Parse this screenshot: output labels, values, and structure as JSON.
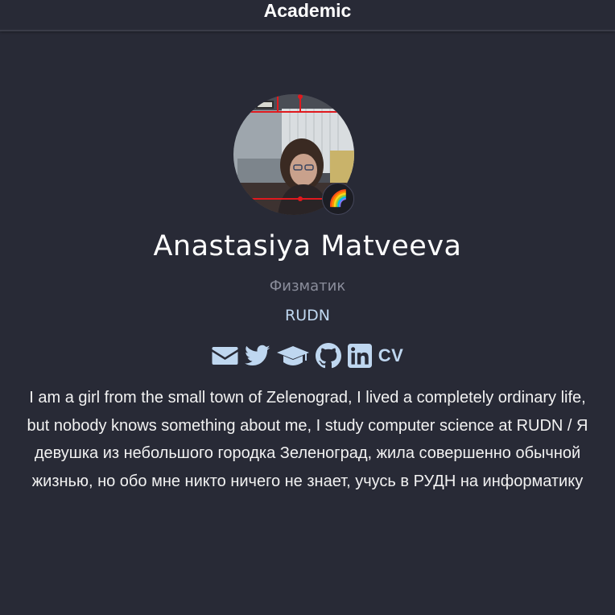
{
  "navbar": {
    "brand": "Academic"
  },
  "profile": {
    "name": "Anastasiya Matveeva",
    "role": "Физматик",
    "organization": "RUDN",
    "status_emoji": "🌈",
    "avatar_description_icon": "user-photo",
    "social": [
      {
        "name": "email",
        "icon": "envelope-icon"
      },
      {
        "name": "twitter",
        "icon": "twitter-icon"
      },
      {
        "name": "scholar",
        "icon": "graduation-cap-icon"
      },
      {
        "name": "github",
        "icon": "github-icon"
      },
      {
        "name": "linkedin",
        "icon": "linkedin-icon"
      },
      {
        "name": "cv",
        "label": "CV",
        "icon": "cv-icon"
      }
    ],
    "bio": "I am a girl from the small town of Zelenograd, I lived a completely ordinary life, but nobody knows something about me, I study computer science at RUDN / Я девушка из небольшого городка Зеленоград, жила совершенно обычной жизнью, но обо мне никто ничего не знает, учусь в РУДН на информатику"
  },
  "colors": {
    "background": "#282a36",
    "accent": "#bfd7f0",
    "muted": "#8a8d9b",
    "text": "#f2f2f2"
  }
}
